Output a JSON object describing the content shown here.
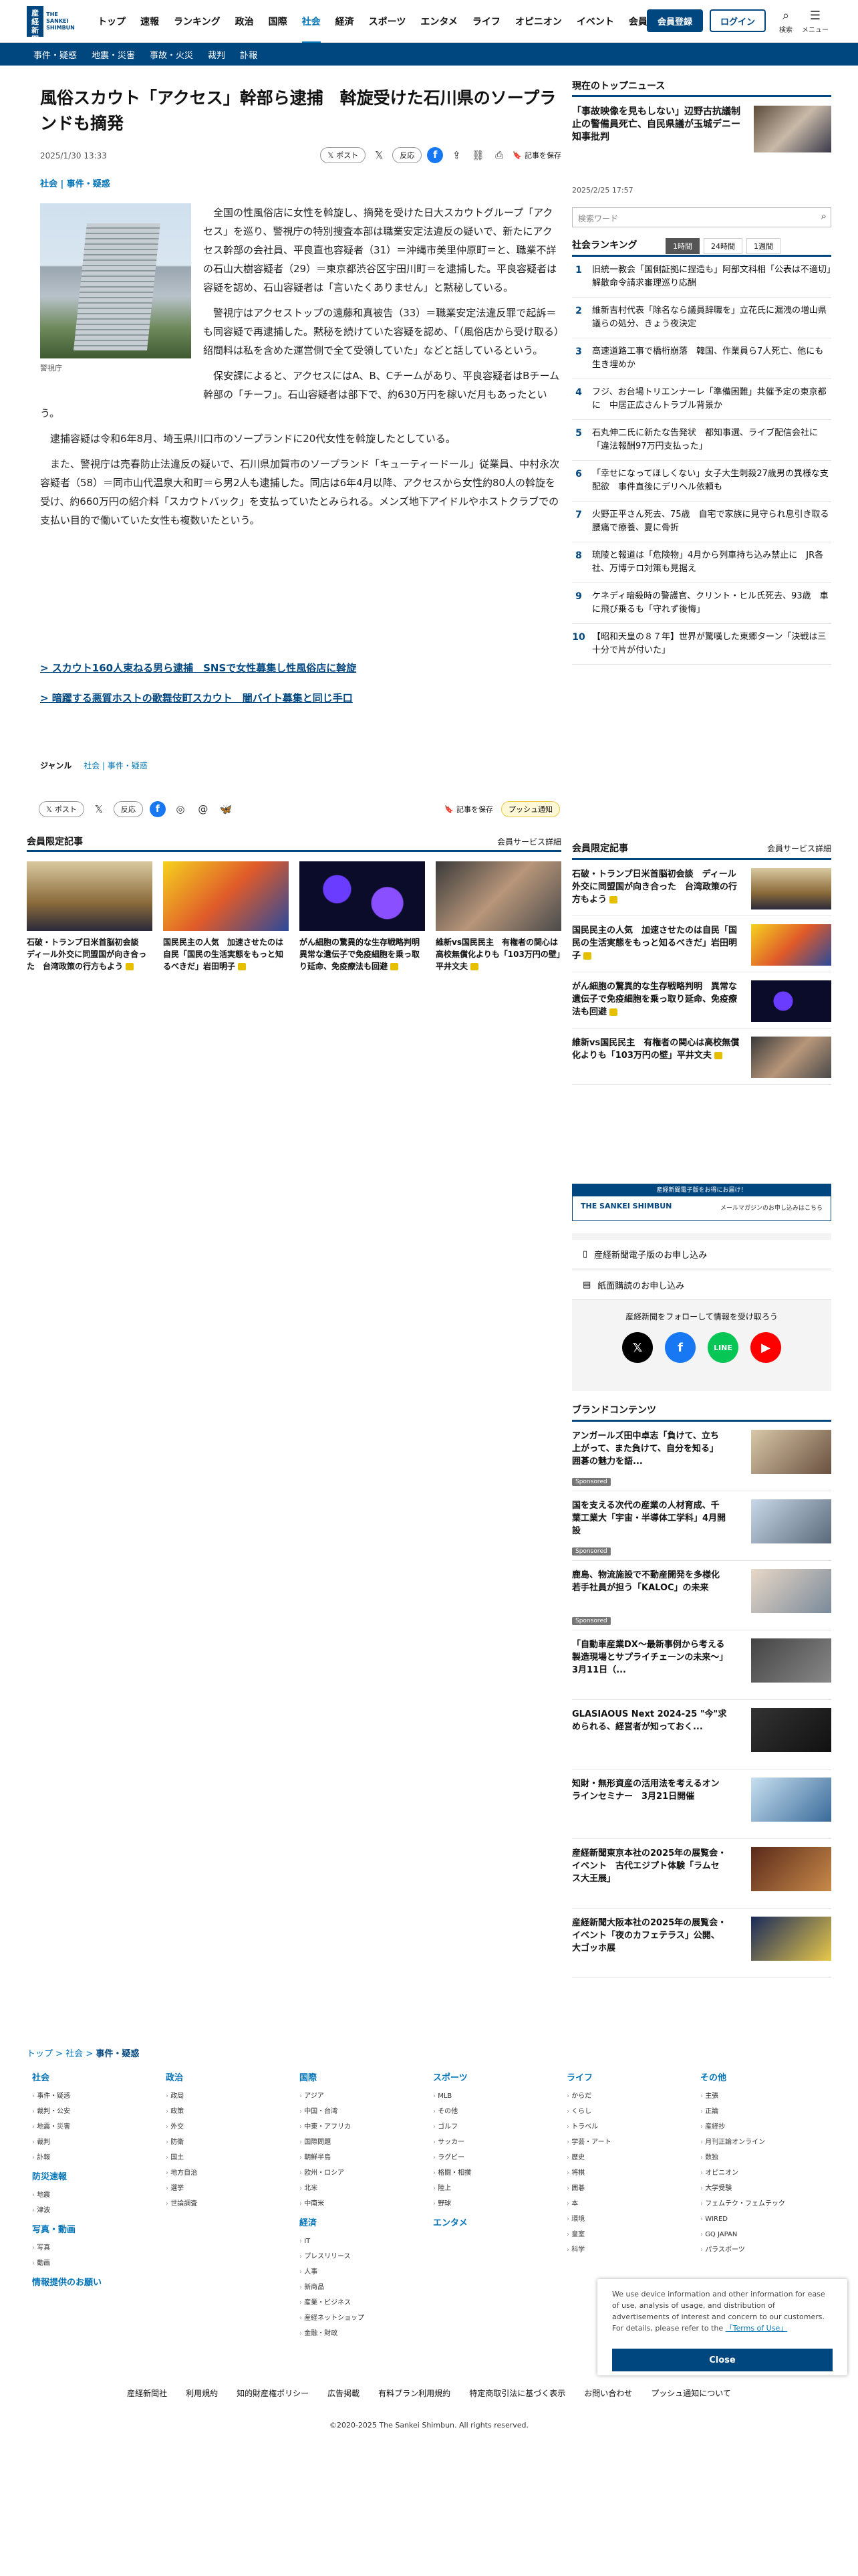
{
  "header": {
    "logo_mark": "産経新聞",
    "logo_text": "THE SANKEI SHIMBUN",
    "nav": [
      "トップ",
      "速報",
      "ランキング",
      "政治",
      "国際",
      "社会",
      "経済",
      "スポーツ",
      "エンタメ",
      "ライフ",
      "オピニオン",
      "イベント",
      "会員限定記事"
    ],
    "active_nav": "社会",
    "register": "会員登録",
    "login": "ログイン",
    "search_label": "検索",
    "menu_label": "メニュー"
  },
  "subnav": [
    "事件・疑惑",
    "地震・災害",
    "事故・火災",
    "裁判",
    "訃報"
  ],
  "article": {
    "title": "風俗スカウト「アクセス」幹部ら逮捕　斡旋受けた石川県のソープランドも摘発",
    "date": "2025/1/30 13:33",
    "post": "ポスト",
    "repost": "反応",
    "save": "記事を保存",
    "categories": "社会 | 事件・疑惑",
    "caption": "警視庁",
    "paragraphs": [
      "全国の性風俗店に女性を斡旋し、摘発を受けた日大スカウトグループ「アクセス」を巡り、警視庁の特別捜査本部は職業安定法違反の疑いで、新たにアクセス幹部の会社員、平良直也容疑者（31）＝沖縄市美里仲原町＝と、職業不詳の石山大樹容疑者（29）＝東京都渋谷区宇田川町＝を逮捕した。平良容疑者は容疑を認め、石山容疑者は「言いたくありません」と黙秘している。",
      "警視庁はアクセストップの遠藤和真被告（33）＝職業安定法違反罪で起訴＝も同容疑で再逮捕した。黙秘を続けていた容疑を認め、「（風俗店から受け取る）紹間料は私を含めた運営側で全て受領していた」などと話しているという。",
      "保安課によると、アクセスにはA、B、Cチームがあり、平良容疑者はBチーム幹部の「チーフ」。石山容疑者は部下で、約630万円を稼いだ月もあったという。",
      "逮捕容疑は令和6年8月、埼玉県川口市のソープランドに20代女性を斡旋したとしている。",
      "また、警視庁は売春防止法違反の疑いで、石川県加賀市のソープランド「キューティードール」従業員、中村永次容疑者（58）＝同市山代温泉大和町＝ら男2人も逮捕した。同店は6年4月以降、アクセスから女性約80人の斡旋を受け、約660万円の紹介料「スカウトバック」を支払っていたとみられる。メンズ地下アイドルやホストクラブでの支払い目的で働いていた女性も複数いたという。"
    ],
    "related": [
      "> スカウト160人束ねる男ら逮捕　SNSで女性募集し性風俗店に斡旋",
      "> 暗躍する悪質ホストの歌舞伎町スカウト　闇バイト募集と同じ手口"
    ],
    "genre_label": "ジャンル",
    "genre_value": "社会 | 事件・疑惑",
    "push": "プッシュ通知"
  },
  "members": {
    "title": "会員限定記事",
    "more": "会員サービス詳細",
    "cards": [
      "石破・トランプ日米首脳初会談　ディール外交に同盟国が向き合った　台湾政策の行方もよう",
      "国民民主の人気　加速させたのは自民「国民の生活実態をもっと知るべきだ」岩田明子",
      "がん細胞の驚異的な生存戦略判明　異常な遺伝子で免疫細胞を乗っ取り延命、免疫療法も回避",
      "維新vs国民民主　有権者の関心は高校無償化よりも「103万円の壁」平井文夫"
    ]
  },
  "sidebar": {
    "top_news_title": "現在のトップニュース",
    "top_news": "「事故映像を見もしない」辺野古抗議制止の警備員死亡、自民県議が玉城デニー知事批判",
    "top_news_date": "2025/2/25 17:57",
    "search_placeholder": "検索ワード",
    "ranking_title": "社会ランキング",
    "ranking_tabs": [
      "1時間",
      "24時間",
      "1週間"
    ],
    "ranking": [
      "旧統一教会「国側証拠に捏造も」阿部文科相「公表は不適切」解散命令請求審理巡り応酬",
      "維新吉村代表「除名なら議員辞職を」立花氏に漏洩の増山県議らの処分、きょう夜決定",
      "高速道路工事で橋桁崩落　韓国、作業員ら7人死亡、他にも生き埋めか",
      "フジ、お台場トリエンナーレ「準備困難」共催予定の東京都に　中居正広さんトラブル背景か",
      "石丸伸二氏に新たな告発状　都知事選、ライブ配信会社に「違法報酬97万円支払った」",
      "「幸せになってほしくない」女子大生刺殺27歳男の異様な支配欲　事件直後にデリヘル依頼も",
      "火野正平さん死去、75歳　自宅で家族に見守られ息引き取る　腰痛で療養、夏に骨折",
      "琉陵と報道は「危険物」4月から列車持ち込み禁止に　JR各社、万博テロ対策も見据え",
      "ケネディ暗殺時の警護官、クリント・ヒル氏死去、93歳　車に飛び乗るも「守れず後悔」",
      "【昭和天皇の８７年】世界が驚嘆した東郷ターン「決戦は三十分で片が付いた」"
    ],
    "members_title": "会員限定記事",
    "members_more": "会員サービス詳細",
    "members": [
      "石破・トランプ日米首脳初会談　ディール外交に同盟国が向き合った　台湾政策の行方もよう",
      "国民民主の人気　加速させたのは自民「国民の生活実態をもっと知るべきだ」岩田明子",
      "がん細胞の驚異的な生存戦略判明　異常な遺伝子で免疫細胞を乗っ取り延命、免疫療法も回避",
      "維新vs国民民主　有権者の関心は高校無償化よりも「103万円の壁」平井文夫"
    ],
    "banner_top": "産経新聞電子版をお得にお届け！",
    "banner_brand": "THE SANKEI SHIMBUN",
    "banner_cta": "メールマガジンのお申し込みはこちら",
    "sub_digital": "産経新聞電子版のお申し込み",
    "sub_paper": "紙面購読のお申し込み",
    "follow": "産経新聞をフォローして情報を受け取ろう",
    "brand_title": "ブランドコンテンツ",
    "sponsored": "Sponsored",
    "brand": [
      "アンガールズ田中卓志「負けて、立ち上がって、また負けて、自分を知る」 囲碁の魅力を語...",
      "国を支える次代の産業の人材育成、千葉工業大「宇宙・半導体工学科」4月開設",
      "鹿島、物流施設で不動産開発を多様化　若手社員が担う「KALOC」の未来",
      "「自動車産業DX～最新事例から考える製造現場とサプライチェーンの未来～」3月11日（...",
      "GLASIAOUS Next 2024-25 \"今\"求められる、経営者が知っておく...",
      "知財・無形資産の活用法を考えるオンラインセミナー　3月21日開催",
      "産経新聞東京本社の2025年の展覧会・イベント　古代エジプト体験「ラムセス大王展」",
      "産経新聞大阪本社の2025年の展覧会・イベント「夜のカフェテラス」公開、大ゴッホ展"
    ]
  },
  "footer": {
    "breadcrumb": [
      "トップ",
      "社会",
      "事件・疑惑"
    ],
    "columns": [
      {
        "title": "社会",
        "items": [
          "事件・疑惑",
          "裁判・公安",
          "地震・災害",
          "裁判",
          "訃報"
        ],
        "extra": [
          [
            "防災速報",
            [
              "地震",
              "津波"
            ]
          ],
          [
            "写真・動画",
            [
              "写真",
              "動画"
            ]
          ],
          [
            "情報提供のお願い",
            []
          ]
        ]
      },
      {
        "title": "政治",
        "items": [
          "政局",
          "政策",
          "外交",
          "防衛",
          "国土",
          "地方自治",
          "選挙",
          "世論調査"
        ]
      },
      {
        "title": "国際",
        "items": [
          "アジア",
          "中国・台湾",
          "中東・アフリカ",
          "国際問題",
          "朝鮮半島",
          "欧州・ロシア",
          "北米",
          "中南米"
        ],
        "extra": [
          [
            "経済",
            [
              "IT",
              "プレスリリース",
              "人事",
              "新商品",
              "産業・ビジネス",
              "産経ネットショップ",
              "金融・財政"
            ]
          ]
        ]
      },
      {
        "title": "スポーツ",
        "items": [
          "MLB",
          "その他",
          "ゴルフ",
          "サッカー",
          "ラグビー",
          "格闘・相撲",
          "陸上",
          "野球"
        ],
        "extra": [
          [
            "エンタメ",
            []
          ]
        ]
      },
      {
        "title": "ライフ",
        "items": [
          "からだ",
          "くらし",
          "トラベル",
          "学芸・アート",
          "歴史",
          "将棋",
          "囲碁",
          "本",
          "環境",
          "皇室",
          "科学"
        ]
      },
      {
        "title": "その他",
        "items": [
          "主張",
          "正論",
          "産経抄",
          "月刊正論オンライン",
          "数独",
          "オピニオン",
          "大学受験",
          "フェムテク・フェムテック",
          "WIRED",
          "GQ JAPAN",
          "パラスポーツ"
        ]
      }
    ],
    "links": [
      "産経新聞社",
      "利用規約",
      "知的財産権ポリシー",
      "広告掲載",
      "有料プラン利用規約",
      "特定商取引法に基づく表示",
      "お問い合わせ",
      "プッシュ通知について"
    ],
    "copyright": "©2020-2025 The Sankei Shimbun. All rights reserved."
  },
  "cookie": {
    "text": "We use device information and other information for ease of use, analysis of usage, and distribution of advertisements of interest and concern to our customers. For details, please refer to the",
    "link": "「Terms of Use」",
    "close": "Close"
  }
}
